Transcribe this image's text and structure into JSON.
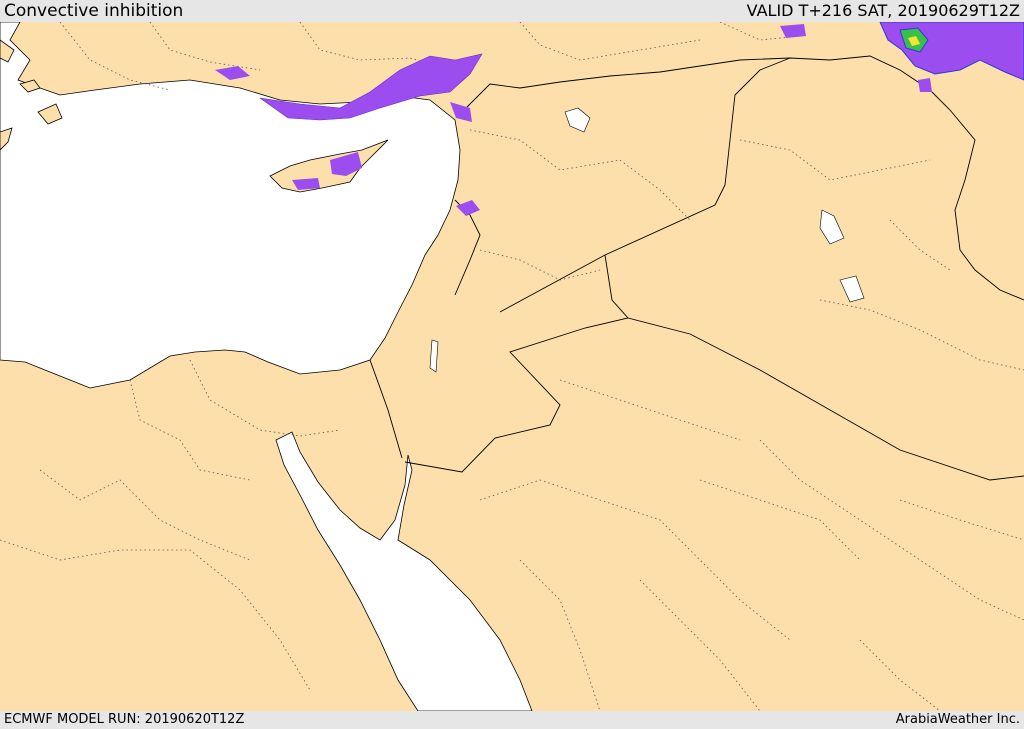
{
  "header": {
    "title": "Convective inhibition",
    "valid": "VALID T+216 SAT, 20190629T12Z"
  },
  "footer": {
    "model_run": "ECMWF MODEL RUN: 20190620T12Z",
    "credit": "ArabiaWeather Inc."
  },
  "colors": {
    "land": "#fddfab",
    "sea": "#ffffff",
    "cin_weak": "#9b4df0",
    "cin_moderate": "#2a3ad8",
    "cin_strong": "#39c04a",
    "cin_extreme": "#f2e53a",
    "border": "#000000",
    "province": "#555555",
    "bar": "#e6e6e6"
  }
}
